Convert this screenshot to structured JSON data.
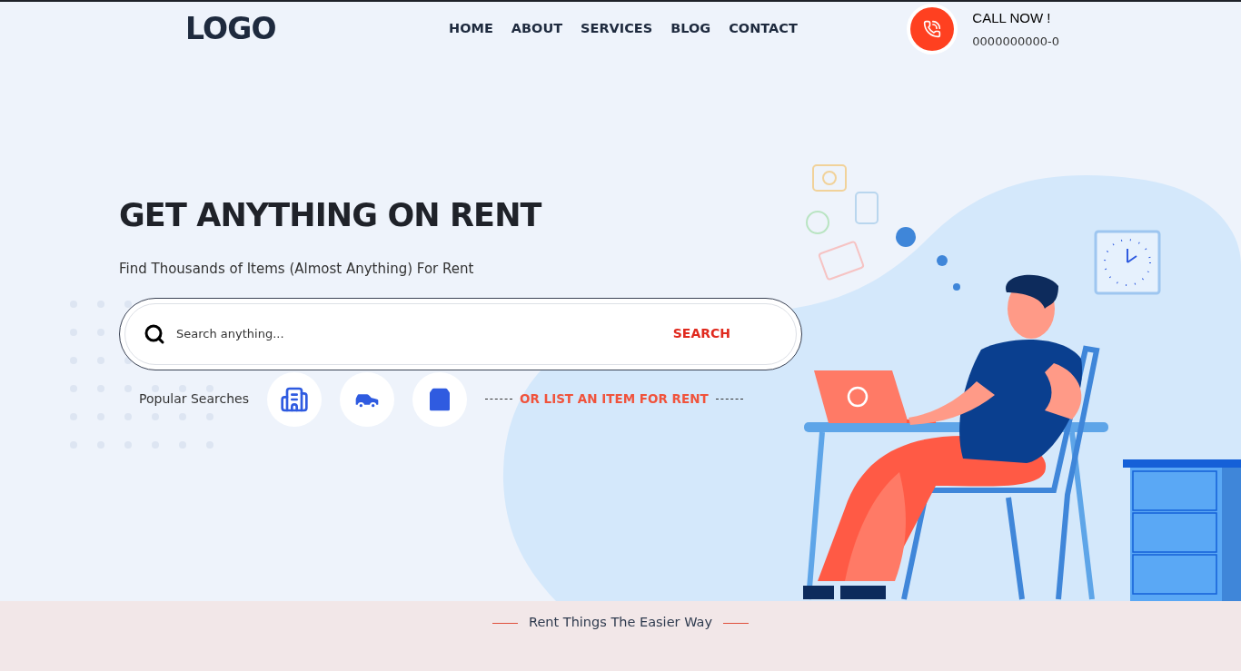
{
  "header": {
    "logo": "LOGO",
    "nav": [
      {
        "label": "HOME"
      },
      {
        "label": "ABOUT"
      },
      {
        "label": "SERVICES"
      },
      {
        "label": "BLOG"
      },
      {
        "label": "CONTACT"
      }
    ],
    "call": {
      "title": "CALL NOW !",
      "phone": "0000000000-0"
    }
  },
  "hero": {
    "title": "GET ANYTHING ON RENT",
    "subtitle": "Find Thousands of Items (Almost Anything) For Rent",
    "search": {
      "placeholder": "Search anything...",
      "button": "SEARCH"
    },
    "popular": {
      "label": "Popular Searches",
      "items": [
        {
          "kind": "building"
        },
        {
          "kind": "car"
        },
        {
          "kind": "bag"
        }
      ]
    },
    "list_link": "OR LIST AN ITEM FOR RENT"
  },
  "tagline": "Rent Things The Easier Way"
}
